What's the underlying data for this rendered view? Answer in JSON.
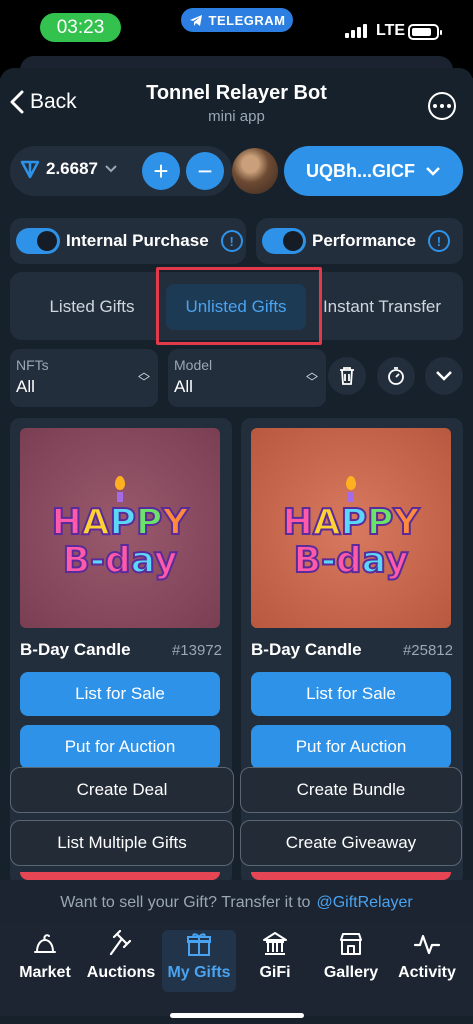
{
  "status": {
    "time": "03:23",
    "app_pill": "TELEGRAM",
    "network": "LTE"
  },
  "header": {
    "back_label": "Back",
    "title": "Tonnel Relayer Bot",
    "subtitle": "mini app"
  },
  "wallet": {
    "balance": "2.6687",
    "address": "UQBh...GICF"
  },
  "toggles": [
    {
      "label": "Internal Purchase",
      "on": true
    },
    {
      "label": "Performance",
      "on": true
    }
  ],
  "tabs": [
    {
      "label": "Listed Gifts",
      "active": false
    },
    {
      "label": "Unlisted Gifts",
      "active": true
    },
    {
      "label": "Instant Transfer",
      "active": false
    }
  ],
  "filters": [
    {
      "label": "NFTs",
      "value": "All"
    },
    {
      "label": "Model",
      "value": "All"
    }
  ],
  "cards": [
    {
      "name": "B-Day Candle",
      "id": "#13972",
      "bg": "#8a4a5e",
      "list_label": "List for Sale",
      "auction_label": "Put for Auction"
    },
    {
      "name": "B-Day Candle",
      "id": "#25812",
      "bg": "#c8684f",
      "list_label": "List for Sale",
      "auction_label": "Put for Auction"
    }
  ],
  "art_text": {
    "line1": [
      "H",
      "A",
      "P",
      "P",
      "Y"
    ],
    "line2": [
      "B",
      "-",
      "d",
      "a",
      "y"
    ]
  },
  "actions": {
    "create_deal": "Create Deal",
    "create_bundle": "Create Bundle",
    "list_multiple": "List Multiple Gifts",
    "create_giveaway": "Create Giveaway"
  },
  "hint": {
    "text": "Want to sell your Gift? Transfer it to",
    "link": "@GiftRelayer"
  },
  "nav": [
    {
      "label": "Market",
      "icon": "market-icon",
      "active": false
    },
    {
      "label": "Auctions",
      "icon": "hammer-icon",
      "active": false
    },
    {
      "label": "My Gifts",
      "icon": "gift-icon",
      "active": true
    },
    {
      "label": "GiFi",
      "icon": "bank-icon",
      "active": false
    },
    {
      "label": "Gallery",
      "icon": "store-icon",
      "active": false
    },
    {
      "label": "Activity",
      "icon": "activity-icon",
      "active": false
    }
  ],
  "colors": {
    "accent": "#2e93e8",
    "highlight": "#e23a4a",
    "danger": "#e64553"
  }
}
